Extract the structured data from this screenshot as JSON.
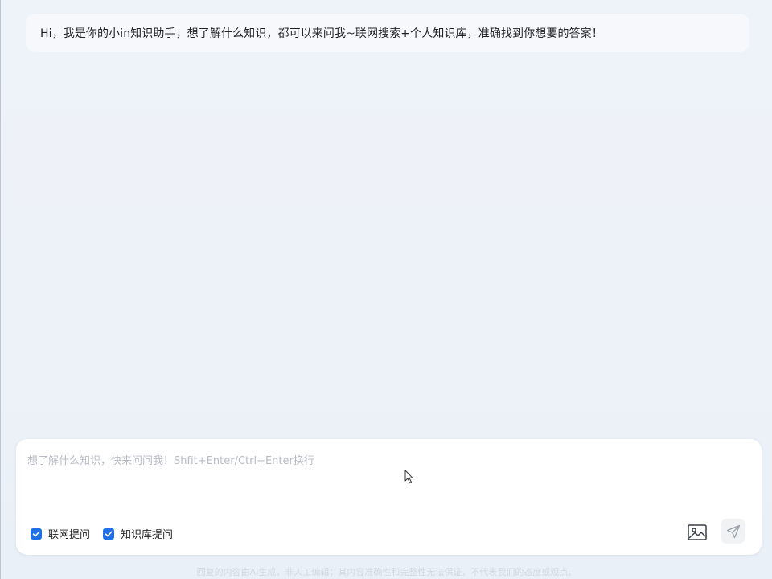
{
  "chat": {
    "greeting": "Hi，我是你的小in知识助手，想了解什么知识，都可以来问我~联网搜索+个人知识库，准确找到你想要的答案！"
  },
  "composer": {
    "placeholder": "想了解什么知识，快来问问我！Shfit+Enter/Ctrl+Enter换行",
    "value": "",
    "options": [
      {
        "label": "联网提问",
        "checked": true
      },
      {
        "label": "知识库提问",
        "checked": true
      }
    ],
    "image_icon": "image-icon",
    "send_icon": "send-icon"
  },
  "footer": {
    "disclaimer": "回复的内容由AI生成，非人工编辑；其内容准确性和完整性无法保证，不代表我们的态度或观点。"
  },
  "colors": {
    "accent": "#1f6fe5",
    "background": "#eef3f9",
    "card": "#ffffff"
  }
}
